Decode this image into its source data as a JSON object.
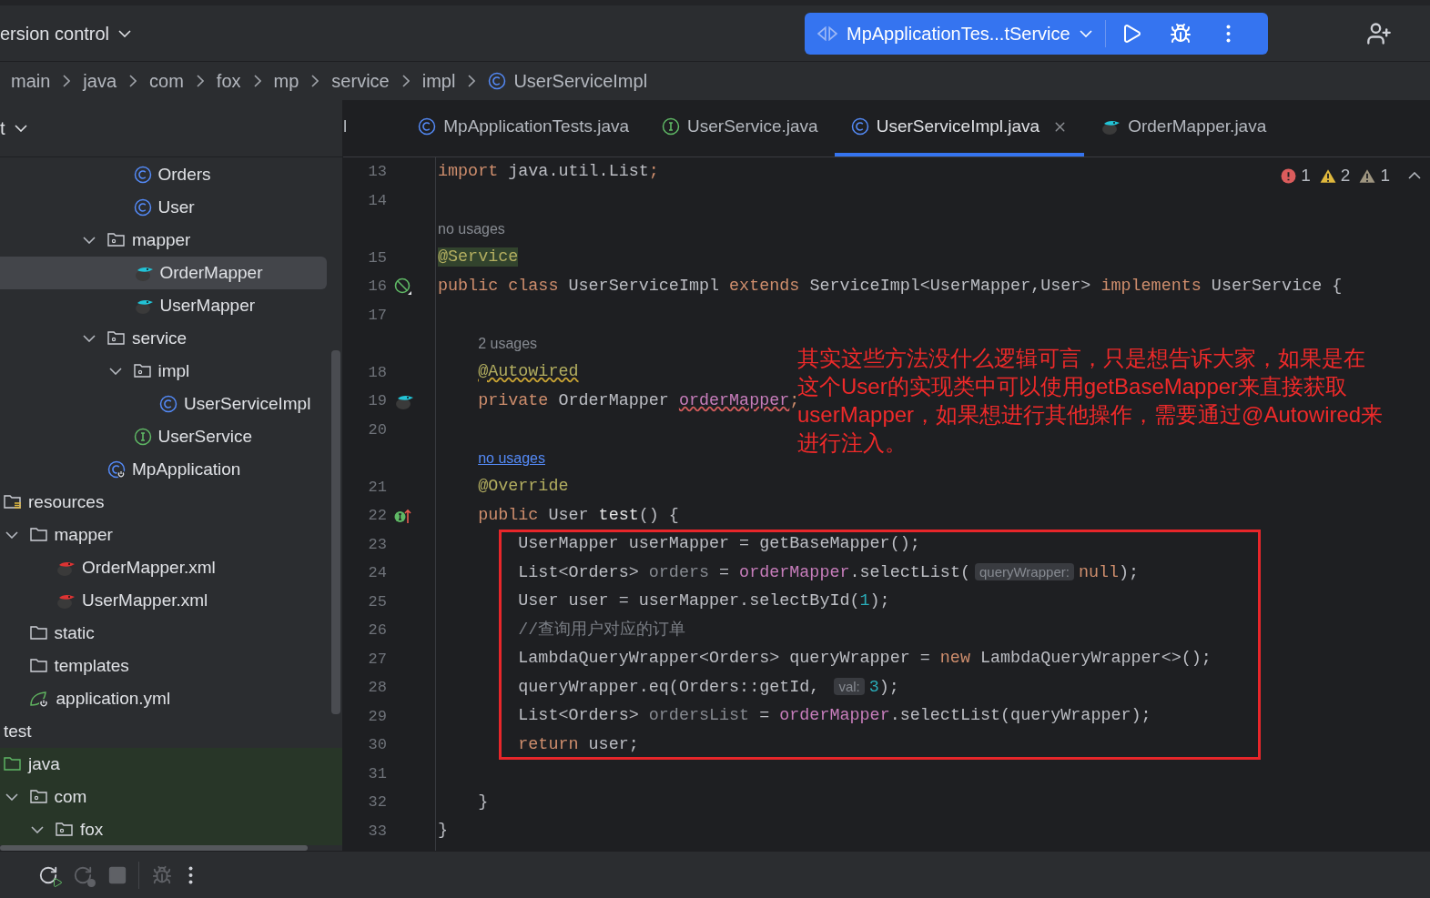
{
  "toolbar": {
    "vcs": "ersion control",
    "run_config": "MpApplicationTes...tService"
  },
  "breadcrumbs": [
    {
      "label": "main",
      "kind": "folder"
    },
    {
      "label": "java",
      "kind": "folder"
    },
    {
      "label": "com",
      "kind": "folder"
    },
    {
      "label": "fox",
      "kind": "folder"
    },
    {
      "label": "mp",
      "kind": "folder"
    },
    {
      "label": "service",
      "kind": "folder"
    },
    {
      "label": "impl",
      "kind": "folder"
    },
    {
      "label": "UserServiceImpl",
      "kind": "class"
    }
  ],
  "project_panel": {
    "title": "t"
  },
  "tree": [
    {
      "children": [
        {
          "children": [
            {
              "children": [
                {
                  "children": [
                    {
                      "children": [
                        {
                          "label": "Orders",
                          "kind": "class",
                          "selected": false
                        },
                        {
                          "label": "User",
                          "kind": "class",
                          "selected": false
                        }
                      ]
                    },
                    {
                      "label": "mapper",
                      "kind": "package",
                      "expanded": true,
                      "selected": false,
                      "children": [
                        {
                          "label": "OrderMapper",
                          "kind": "mapper",
                          "selected": true
                        },
                        {
                          "label": "UserMapper",
                          "kind": "mapper",
                          "selected": false
                        }
                      ]
                    },
                    {
                      "label": "service",
                      "kind": "package",
                      "expanded": true,
                      "selected": false,
                      "children": [
                        {
                          "label": "impl",
                          "kind": "package",
                          "expanded": true,
                          "selected": false,
                          "children": [
                            {
                              "label": "UserServiceImpl",
                              "kind": "class",
                              "selected": false
                            }
                          ]
                        },
                        {
                          "label": "UserService",
                          "kind": "interface",
                          "selected": false
                        }
                      ]
                    },
                    {
                      "label": "MpApplication",
                      "kind": "app",
                      "selected": false
                    }
                  ]
                }
              ]
            }
          ]
        }
      ]
    },
    {
      "label": "resources",
      "kind": "resources",
      "selected": false,
      "children": [
        {
          "label": "mapper",
          "kind": "folder",
          "expanded": true,
          "selected": false,
          "children": [
            {
              "label": "OrderMapper.xml",
              "kind": "xml",
              "selected": false
            },
            {
              "label": "UserMapper.xml",
              "kind": "xml",
              "selected": false
            }
          ]
        },
        {
          "label": "static",
          "kind": "folder",
          "selected": false
        },
        {
          "label": "templates",
          "kind": "folder",
          "selected": false
        },
        {
          "label": "application.yml",
          "kind": "yaml",
          "selected": false
        }
      ]
    },
    {
      "label": "test",
      "kind": "plain",
      "selected": false
    },
    {
      "label": "java",
      "kind": "source",
      "selected": false,
      "children": [
        {
          "label": "com",
          "kind": "package",
          "expanded": true,
          "selected": false,
          "children": [
            {
              "label": "fox",
              "kind": "package",
              "expanded": true,
              "selected": false
            }
          ]
        }
      ]
    }
  ],
  "tabs": [
    {
      "label": "l",
      "kind": "partial",
      "selected": false
    },
    {
      "label": "MpApplicationTests.java",
      "kind": "class",
      "selected": false
    },
    {
      "label": "UserService.java",
      "kind": "interface",
      "selected": false
    },
    {
      "label": "UserServiceImpl.java",
      "kind": "class",
      "selected": true
    },
    {
      "label": "OrderMapper.java",
      "kind": "mapper",
      "selected": false
    }
  ],
  "problems": [
    {
      "kind": "error",
      "count": "1"
    },
    {
      "kind": "warning",
      "count": "2"
    },
    {
      "kind": "weak",
      "count": "1"
    }
  ],
  "lines": [
    {
      "kind": "code",
      "number": "13",
      "segments": [
        {
          "text": "import ",
          "kind": "kw"
        },
        {
          "text": "java.util.List",
          "kind": "plain"
        },
        {
          "text": ";",
          "kind": "kw"
        }
      ]
    },
    {
      "kind": "code",
      "number": "14"
    },
    {
      "kind": "hint",
      "indented": false,
      "segments": [
        {
          "text": "no usages",
          "kind": "usage"
        }
      ]
    },
    {
      "kind": "code",
      "number": "15",
      "segments": [
        {
          "text": "@Service",
          "kind": "ann",
          "highlight": true
        }
      ]
    },
    {
      "kind": "code",
      "number": "16",
      "gutter": {
        "kind": "bean"
      },
      "segments": [
        {
          "text": "public class ",
          "kind": "kw"
        },
        {
          "text": "UserServiceImpl ",
          "kind": "plain"
        },
        {
          "text": "extends ",
          "kind": "kw"
        },
        {
          "text": "ServiceImpl<UserMapper,User> ",
          "kind": "plain"
        },
        {
          "text": "implements ",
          "kind": "kw"
        },
        {
          "text": "UserService {",
          "kind": "plain"
        }
      ]
    },
    {
      "kind": "code",
      "number": "17"
    },
    {
      "kind": "hint",
      "indented": true,
      "segments": [
        {
          "text": "2 usages",
          "kind": "usage"
        }
      ]
    },
    {
      "kind": "code",
      "number": "18",
      "segments": [
        {
          "text": "    @Autowired",
          "kind": "ann",
          "squiggle": true
        }
      ]
    },
    {
      "kind": "code",
      "number": "19",
      "gutter": {
        "kind": "mapper"
      },
      "segments": [
        {
          "text": "    private ",
          "kind": "kw"
        },
        {
          "text": "OrderMapper ",
          "kind": "plain"
        },
        {
          "text": "orderMapper",
          "kind": "field",
          "squiggle": true
        },
        {
          "text": ";",
          "kind": "kw"
        }
      ]
    },
    {
      "kind": "code",
      "number": "20"
    },
    {
      "kind": "hint",
      "indented": true,
      "segments": [
        {
          "text": "no usages",
          "kind": "link"
        }
      ]
    },
    {
      "kind": "code",
      "number": "21",
      "segments": [
        {
          "text": "    @Override",
          "kind": "ann"
        }
      ]
    },
    {
      "kind": "code",
      "number": "22",
      "gutter": {
        "kind": "implements"
      },
      "segments": [
        {
          "text": "    public ",
          "kind": "kw"
        },
        {
          "text": "User ",
          "kind": "plain"
        },
        {
          "text": "test",
          "kind": "decl"
        },
        {
          "text": "() {",
          "kind": "plain"
        }
      ]
    },
    {
      "kind": "box",
      "lines": [
        {
          "kind": "code",
          "number": "23",
          "segments": [
            {
              "text": "        UserMapper userMapper = getBaseMapper();",
              "kind": "plain"
            }
          ]
        },
        {
          "kind": "code",
          "number": "24",
          "segments": [
            {
              "text": "        List<Orders> ",
              "kind": "plain"
            },
            {
              "text": "orders",
              "kind": "unused"
            },
            {
              "text": " = ",
              "kind": "plain"
            },
            {
              "text": "orderMapper",
              "kind": "field"
            },
            {
              "text": ".selectList(",
              "kind": "plain"
            },
            {
              "text": "queryWrapper:",
              "kind": "inlay"
            },
            {
              "text": "null",
              "kind": "kw"
            },
            {
              "text": ");",
              "kind": "plain"
            }
          ]
        },
        {
          "kind": "code",
          "number": "25",
          "segments": [
            {
              "text": "        User user = userMapper.selectById(",
              "kind": "plain"
            },
            {
              "text": "1",
              "kind": "num"
            },
            {
              "text": ");",
              "kind": "plain"
            }
          ]
        },
        {
          "kind": "code",
          "number": "26",
          "segments": [
            {
              "text": "        //查询用户对应的订单",
              "kind": "comment"
            }
          ]
        },
        {
          "kind": "code",
          "number": "27",
          "segments": [
            {
              "text": "        LambdaQueryWrapper<Orders> queryWrapper = ",
              "kind": "plain"
            },
            {
              "text": "new ",
              "kind": "kw"
            },
            {
              "text": "LambdaQueryWrapper<>();",
              "kind": "plain"
            }
          ]
        },
        {
          "kind": "code",
          "number": "28",
          "segments": [
            {
              "text": "        queryWrapper.eq(Orders::getId, ",
              "kind": "plain"
            },
            {
              "text": "val:",
              "kind": "inlay"
            },
            {
              "text": "3",
              "kind": "num"
            },
            {
              "text": ");",
              "kind": "plain"
            }
          ]
        },
        {
          "kind": "code",
          "number": "29",
          "segments": [
            {
              "text": "        List<Orders> ",
              "kind": "plain"
            },
            {
              "text": "ordersList",
              "kind": "unused"
            },
            {
              "text": " = ",
              "kind": "plain"
            },
            {
              "text": "orderMapper",
              "kind": "field"
            },
            {
              "text": ".selectList(queryWrapper);",
              "kind": "plain"
            }
          ]
        },
        {
          "kind": "code",
          "number": "30",
          "segments": [
            {
              "text": "        return ",
              "kind": "kw"
            },
            {
              "text": "user;",
              "kind": "plain"
            }
          ]
        }
      ]
    },
    {
      "kind": "code",
      "number": "31"
    },
    {
      "kind": "code",
      "number": "32",
      "segments": [
        {
          "text": "    }",
          "kind": "plain"
        }
      ]
    },
    {
      "kind": "code",
      "number": "33",
      "segments": [
        {
          "text": "}",
          "kind": "plain"
        }
      ]
    }
  ],
  "annotation": {
    "lines": [
      "其实这些方法没什么逻辑可言，只是想告诉大家，如果是在",
      "这个User的实现类中可以使用getBaseMapper来直接获取",
      "userMapper，如果想进行其他操作，需要通过@Autowired来",
      "进行注入。"
    ]
  },
  "bottom_toolbar": [
    {
      "kind": "rerun",
      "disabled": false
    },
    {
      "kind": "rerun-failed",
      "disabled": true
    },
    {
      "kind": "stop",
      "disabled": true
    },
    {
      "kind": "debug",
      "disabled": true
    },
    {
      "kind": "more",
      "disabled": false
    }
  ]
}
